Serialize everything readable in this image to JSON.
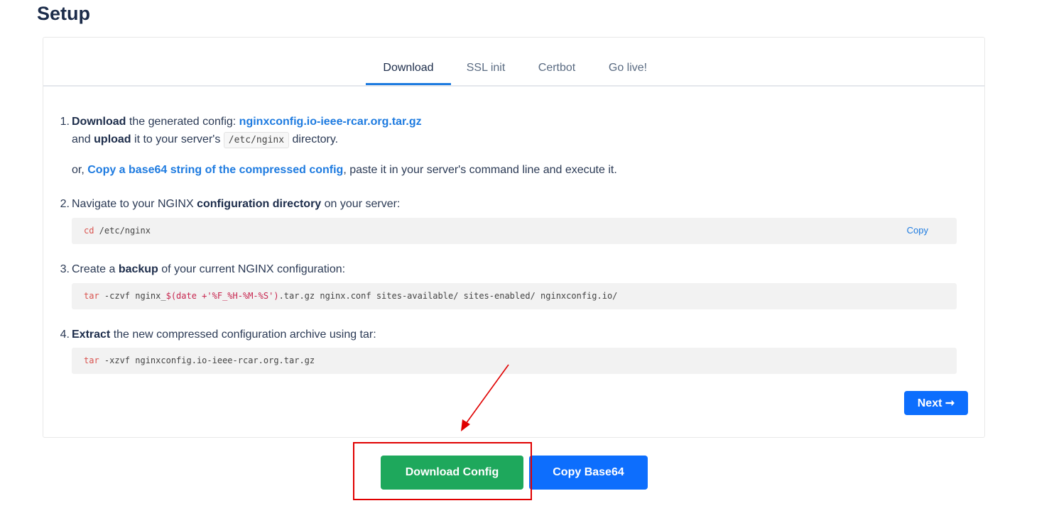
{
  "page": {
    "title": "Setup"
  },
  "tabs": [
    {
      "label": "Download",
      "active": true
    },
    {
      "label": "SSL init",
      "active": false
    },
    {
      "label": "Certbot",
      "active": false
    },
    {
      "label": "Go live!",
      "active": false
    }
  ],
  "steps": {
    "s1": {
      "num": "1.",
      "bold1": "Download",
      "text1": " the generated config: ",
      "file_link": "nginxconfig.io-ieee-rcar.org.tar.gz",
      "text2": "and ",
      "bold2": "upload",
      "text3": " it to your server's ",
      "path": "/etc/nginx",
      "text4": " directory.",
      "or": "or, ",
      "base64_link": "Copy a base64 string of the compressed config",
      "text5": ", paste it in your server's command line and execute it."
    },
    "s2": {
      "num": "2.",
      "text1": "Navigate to your NGINX ",
      "bold": "configuration directory",
      "text2": " on your server:",
      "cmd_kw": "cd",
      "cmd_rest": " /etc/nginx",
      "copy_label": "Copy"
    },
    "s3": {
      "num": "3.",
      "text1": "Create a ",
      "bold": "backup",
      "text2": " of your current NGINX configuration:",
      "cmd_kw": "tar",
      "cmd_part1": " -czvf nginx_",
      "cmd_sub": "$(date +'%F_%H-%M-%S')",
      "cmd_part2": ".tar.gz nginx.conf sites-available/ sites-enabled/ nginxconfig.io/"
    },
    "s4": {
      "num": "4.",
      "bold": "Extract",
      "text1": " the new compressed configuration archive using tar:",
      "cmd_kw": "tar",
      "cmd_rest": " -xzvf nginxconfig.io-ieee-rcar.org.tar.gz"
    }
  },
  "buttons": {
    "next": "Next ➞",
    "download_config": "Download Config",
    "copy_base64": "Copy Base64"
  },
  "colors": {
    "accent": "#1e7be0",
    "primary": "#0d6efd",
    "success": "#1ea85c",
    "annotation": "#e00000"
  }
}
